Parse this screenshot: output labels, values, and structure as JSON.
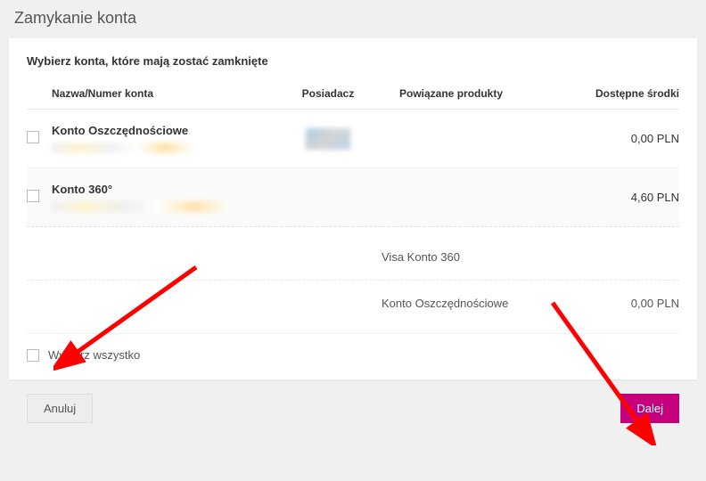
{
  "header": {
    "title": "Zamykanie konta"
  },
  "section_title": "Wybierz konta, które mają zostać zamknięte",
  "columns": {
    "name": "Nazwa/Numer konta",
    "owner": "Posiadacz",
    "products": "Powiązane produkty",
    "funds": "Dostępne środki"
  },
  "accounts": [
    {
      "name": "Konto Oszczędnościowe",
      "funds": "0,00 PLN"
    },
    {
      "name": "Konto 360°",
      "funds": "4,60 PLN"
    }
  ],
  "linked_products": [
    {
      "name": "Visa Konto 360",
      "funds": ""
    },
    {
      "name": "Konto Oszczędnościowe",
      "funds": "0,00 PLN"
    }
  ],
  "select_all_label": "Wybierz wszystko",
  "buttons": {
    "cancel": "Anuluj",
    "next": "Dalej"
  },
  "colors": {
    "accent": "#c5007c",
    "arrow": "#ff0000"
  }
}
